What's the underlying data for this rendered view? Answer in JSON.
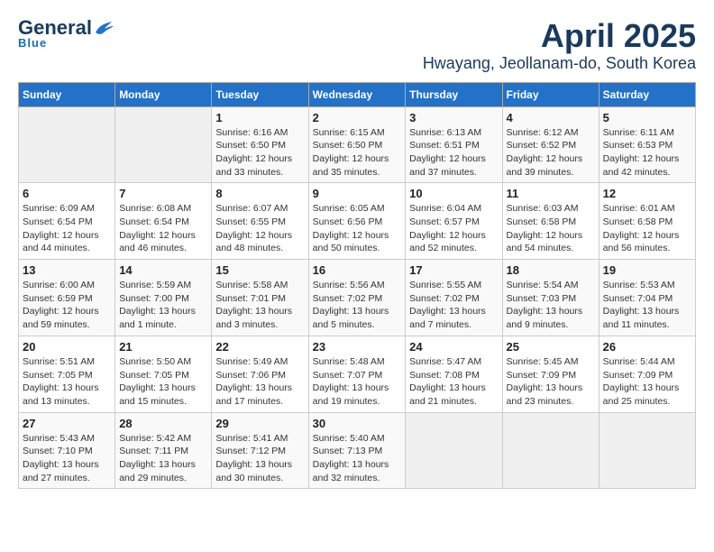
{
  "header": {
    "logo": {
      "general": "General",
      "blue": "Blue",
      "tagline": "Blue"
    },
    "title": "April 2025",
    "location": "Hwayang, Jeollanam-do, South Korea"
  },
  "calendar": {
    "days_of_week": [
      "Sunday",
      "Monday",
      "Tuesday",
      "Wednesday",
      "Thursday",
      "Friday",
      "Saturday"
    ],
    "weeks": [
      [
        {
          "day": "",
          "info": ""
        },
        {
          "day": "",
          "info": ""
        },
        {
          "day": "1",
          "info": "Sunrise: 6:16 AM\nSunset: 6:50 PM\nDaylight: 12 hours\nand 33 minutes."
        },
        {
          "day": "2",
          "info": "Sunrise: 6:15 AM\nSunset: 6:50 PM\nDaylight: 12 hours\nand 35 minutes."
        },
        {
          "day": "3",
          "info": "Sunrise: 6:13 AM\nSunset: 6:51 PM\nDaylight: 12 hours\nand 37 minutes."
        },
        {
          "day": "4",
          "info": "Sunrise: 6:12 AM\nSunset: 6:52 PM\nDaylight: 12 hours\nand 39 minutes."
        },
        {
          "day": "5",
          "info": "Sunrise: 6:11 AM\nSunset: 6:53 PM\nDaylight: 12 hours\nand 42 minutes."
        }
      ],
      [
        {
          "day": "6",
          "info": "Sunrise: 6:09 AM\nSunset: 6:54 PM\nDaylight: 12 hours\nand 44 minutes."
        },
        {
          "day": "7",
          "info": "Sunrise: 6:08 AM\nSunset: 6:54 PM\nDaylight: 12 hours\nand 46 minutes."
        },
        {
          "day": "8",
          "info": "Sunrise: 6:07 AM\nSunset: 6:55 PM\nDaylight: 12 hours\nand 48 minutes."
        },
        {
          "day": "9",
          "info": "Sunrise: 6:05 AM\nSunset: 6:56 PM\nDaylight: 12 hours\nand 50 minutes."
        },
        {
          "day": "10",
          "info": "Sunrise: 6:04 AM\nSunset: 6:57 PM\nDaylight: 12 hours\nand 52 minutes."
        },
        {
          "day": "11",
          "info": "Sunrise: 6:03 AM\nSunset: 6:58 PM\nDaylight: 12 hours\nand 54 minutes."
        },
        {
          "day": "12",
          "info": "Sunrise: 6:01 AM\nSunset: 6:58 PM\nDaylight: 12 hours\nand 56 minutes."
        }
      ],
      [
        {
          "day": "13",
          "info": "Sunrise: 6:00 AM\nSunset: 6:59 PM\nDaylight: 12 hours\nand 59 minutes."
        },
        {
          "day": "14",
          "info": "Sunrise: 5:59 AM\nSunset: 7:00 PM\nDaylight: 13 hours\nand 1 minute."
        },
        {
          "day": "15",
          "info": "Sunrise: 5:58 AM\nSunset: 7:01 PM\nDaylight: 13 hours\nand 3 minutes."
        },
        {
          "day": "16",
          "info": "Sunrise: 5:56 AM\nSunset: 7:02 PM\nDaylight: 13 hours\nand 5 minutes."
        },
        {
          "day": "17",
          "info": "Sunrise: 5:55 AM\nSunset: 7:02 PM\nDaylight: 13 hours\nand 7 minutes."
        },
        {
          "day": "18",
          "info": "Sunrise: 5:54 AM\nSunset: 7:03 PM\nDaylight: 13 hours\nand 9 minutes."
        },
        {
          "day": "19",
          "info": "Sunrise: 5:53 AM\nSunset: 7:04 PM\nDaylight: 13 hours\nand 11 minutes."
        }
      ],
      [
        {
          "day": "20",
          "info": "Sunrise: 5:51 AM\nSunset: 7:05 PM\nDaylight: 13 hours\nand 13 minutes."
        },
        {
          "day": "21",
          "info": "Sunrise: 5:50 AM\nSunset: 7:05 PM\nDaylight: 13 hours\nand 15 minutes."
        },
        {
          "day": "22",
          "info": "Sunrise: 5:49 AM\nSunset: 7:06 PM\nDaylight: 13 hours\nand 17 minutes."
        },
        {
          "day": "23",
          "info": "Sunrise: 5:48 AM\nSunset: 7:07 PM\nDaylight: 13 hours\nand 19 minutes."
        },
        {
          "day": "24",
          "info": "Sunrise: 5:47 AM\nSunset: 7:08 PM\nDaylight: 13 hours\nand 21 minutes."
        },
        {
          "day": "25",
          "info": "Sunrise: 5:45 AM\nSunset: 7:09 PM\nDaylight: 13 hours\nand 23 minutes."
        },
        {
          "day": "26",
          "info": "Sunrise: 5:44 AM\nSunset: 7:09 PM\nDaylight: 13 hours\nand 25 minutes."
        }
      ],
      [
        {
          "day": "27",
          "info": "Sunrise: 5:43 AM\nSunset: 7:10 PM\nDaylight: 13 hours\nand 27 minutes."
        },
        {
          "day": "28",
          "info": "Sunrise: 5:42 AM\nSunset: 7:11 PM\nDaylight: 13 hours\nand 29 minutes."
        },
        {
          "day": "29",
          "info": "Sunrise: 5:41 AM\nSunset: 7:12 PM\nDaylight: 13 hours\nand 30 minutes."
        },
        {
          "day": "30",
          "info": "Sunrise: 5:40 AM\nSunset: 7:13 PM\nDaylight: 13 hours\nand 32 minutes."
        },
        {
          "day": "",
          "info": ""
        },
        {
          "day": "",
          "info": ""
        },
        {
          "day": "",
          "info": ""
        }
      ]
    ]
  }
}
